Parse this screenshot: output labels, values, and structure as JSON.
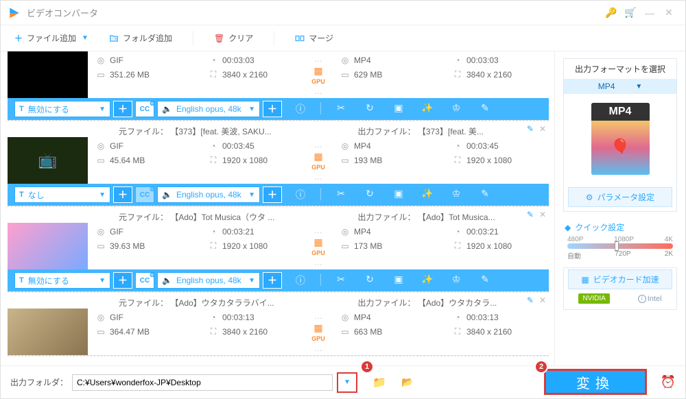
{
  "app": {
    "title": "ビデオコンバータ"
  },
  "toolbar": {
    "add_file": "ファイル追加",
    "add_folder": "フォルダ追加",
    "clear": "クリア",
    "merge": "マージ"
  },
  "items": [
    {
      "thumb": "black",
      "src": {
        "title": "",
        "format": "GIF",
        "duration": "00:03:03",
        "size": "351.26 MB",
        "resolution": "3840 x 2160"
      },
      "dst": {
        "title": "",
        "format": "MP4",
        "duration": "00:03:03",
        "size": "629 MB",
        "resolution": "3840 x 2160"
      },
      "subtitle": "無効にする",
      "audio": "English opus, 48k",
      "cc_enabled": true
    },
    {
      "thumb": "tv",
      "src": {
        "title": "元ファイル： 【373】[feat. 美波, SAKU...",
        "format": "GIF",
        "duration": "00:03:45",
        "size": "45.64 MB",
        "resolution": "1920 x 1080"
      },
      "dst": {
        "title": "出力ファイル： 【373】[feat. 美...",
        "format": "MP4",
        "duration": "00:03:45",
        "size": "193 MB",
        "resolution": "1920 x 1080"
      },
      "subtitle": "なし",
      "audio": "English opus, 48k",
      "cc_enabled": false
    },
    {
      "thumb": "anime",
      "src": {
        "title": "元ファイル： 【Ado】Tot Musica（ウタ ...",
        "format": "GIF",
        "duration": "00:03:21",
        "size": "39.63 MB",
        "resolution": "1920 x 1080"
      },
      "dst": {
        "title": "出力ファイル： 【Ado】Tot Musica...",
        "format": "MP4",
        "duration": "00:03:21",
        "size": "173 MB",
        "resolution": "1920 x 1080"
      },
      "subtitle": "無効にする",
      "audio": "English opus, 48k",
      "cc_enabled": true
    },
    {
      "thumb": "fred",
      "src": {
        "title": "元ファイル： 【Ado】ウタカタララバイ...",
        "format": "GIF",
        "duration": "00:03:13",
        "size": "364.47 MB",
        "resolution": "3840 x 2160"
      },
      "dst": {
        "title": "出力ファイル： 【Ado】ウタカタラ...",
        "format": "MP4",
        "duration": "00:03:13",
        "size": "663 MB",
        "resolution": "3840 x 2160"
      },
      "subtitle": "",
      "audio": "",
      "cc_enabled": true
    }
  ],
  "gpu_label": "GPU",
  "side": {
    "format_title": "出力フォーマットを選択",
    "format_value": "MP4",
    "params_btn": "パラメータ設定",
    "quick_title": "クイック設定",
    "quality": {
      "labels_top": [
        "480P",
        "1080P",
        "4K"
      ],
      "labels_bot": [
        "自動",
        "720P",
        "2K"
      ]
    },
    "gpu_accel_btn": "ビデオカード加速",
    "nvidia": "NVIDIA",
    "intel": "Intel"
  },
  "footer": {
    "label": "出力フォルダ：",
    "path": "C:¥Users¥wonderfox-JP¥Desktop",
    "convert": "変換",
    "badge1": "1",
    "badge2": "2"
  }
}
